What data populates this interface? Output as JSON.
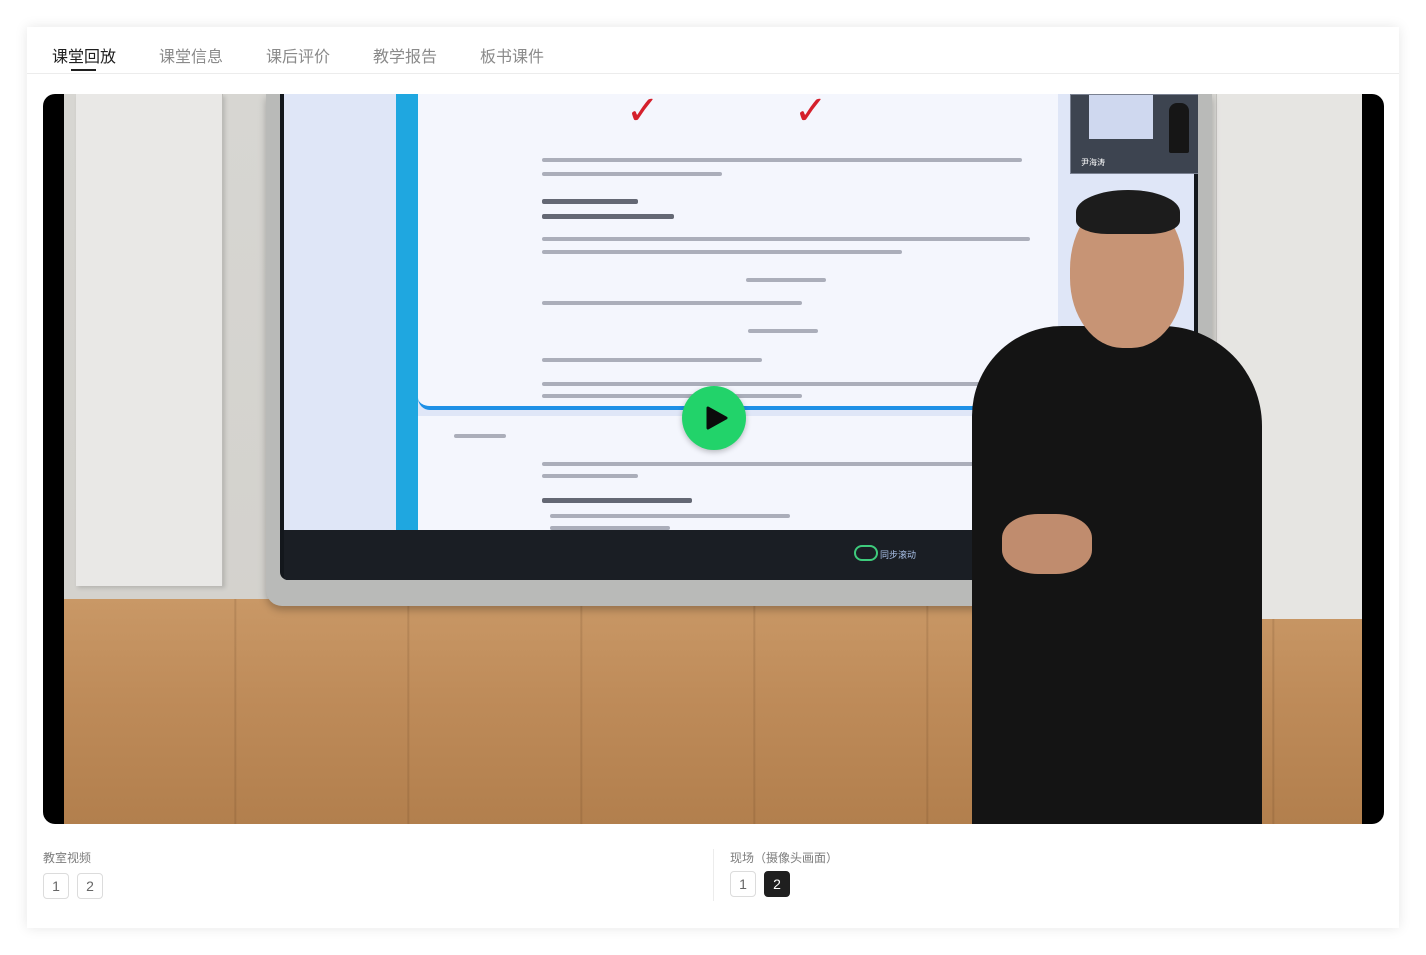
{
  "tabs": [
    {
      "label": "课堂回放",
      "active": true
    },
    {
      "label": "课堂信息",
      "active": false
    },
    {
      "label": "课后评价",
      "active": false
    },
    {
      "label": "教学报告",
      "active": false
    },
    {
      "label": "板书课件",
      "active": false
    }
  ],
  "player": {
    "inset_label": "尹海涛",
    "toolbar_sync_label": "同步滚动",
    "play_icon": "play-icon",
    "accent_color": "#22d36a"
  },
  "classroom_video": {
    "title": "教室视频",
    "items": [
      "1",
      "2"
    ],
    "selected": null
  },
  "live_video": {
    "title": "现场（摄像头画面）",
    "items": [
      "1",
      "2"
    ],
    "selected": "2"
  }
}
